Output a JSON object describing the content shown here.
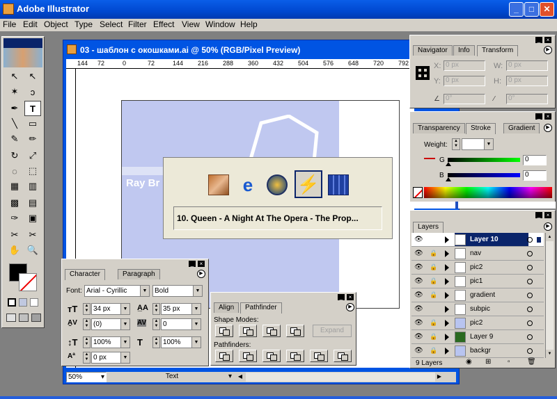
{
  "app": {
    "title": "Adobe Illustrator"
  },
  "menu": [
    "File",
    "Edit",
    "Object",
    "Type",
    "Select",
    "Filter",
    "Effect",
    "View",
    "Window",
    "Help"
  ],
  "doc": {
    "title": "03 - шаблон с окошками.ai @ 50% (RGB/Pixel Preview)",
    "ruler": [
      "144",
      "72",
      "0",
      "72",
      "144",
      "216",
      "288",
      "360",
      "432",
      "504",
      "576",
      "648",
      "720",
      "792"
    ],
    "canvas_text": "Ray Br",
    "zoom": "50%",
    "status": "Text"
  },
  "switcher": {
    "text": "10. Queen - A Night At The Opera - The Prop...",
    "icons": [
      "venus-icon",
      "internet-explorer-icon",
      "media-player-icon",
      "winamp-icon",
      "books-icon"
    ]
  },
  "transform": {
    "tabs": [
      "Navigator",
      "Info",
      "Transform"
    ],
    "x_label": "X:",
    "x": "0 px",
    "y_label": "Y:",
    "y": "0 px",
    "w_label": "W:",
    "w": "0 px",
    "h_label": "H:",
    "h": "0 px",
    "rot": "0°",
    "shear": "0°"
  },
  "stroke": {
    "tabs": [
      "Transparency",
      "Stroke",
      "Gradient"
    ],
    "weight_label": "Weight:",
    "g_label": "G",
    "g": "0",
    "b_label": "B",
    "b": "0"
  },
  "layers": {
    "tab": "Layers",
    "count": "9 Layers",
    "items": [
      {
        "name": "Layer 10",
        "selected": true,
        "lock": false
      },
      {
        "name": "nav",
        "lock": true
      },
      {
        "name": "pic2",
        "lock": true
      },
      {
        "name": "pic1",
        "lock": true
      },
      {
        "name": "gradient",
        "lock": true
      },
      {
        "name": "subpic",
        "lock": false
      },
      {
        "name": "pic2",
        "lock": true,
        "thumb": "#b8c4f0"
      },
      {
        "name": "Layer 9",
        "lock": true,
        "thumb": "#2a6a20"
      },
      {
        "name": "backgr",
        "lock": true,
        "thumb": "#b8c4f0"
      }
    ]
  },
  "character": {
    "tabs": [
      "Character",
      "Paragraph"
    ],
    "font_label": "Font:",
    "font": "Arial - Cyrillic",
    "style": "Bold",
    "size": "34 px",
    "leading": "35 px",
    "kerning": "(0)",
    "tracking": "0",
    "vscale": "100%",
    "hscale": "100%",
    "baseline": "0 px"
  },
  "pathfinder": {
    "tabs": [
      "Align",
      "Pathfinder"
    ],
    "shape_modes": "Shape Modes:",
    "expand": "Expand",
    "pathfinders": "Pathfinders:"
  },
  "colors": {
    "accent": "#0a246a",
    "xp_blue": "#0054e3",
    "artboard": "#c0c8f0"
  }
}
